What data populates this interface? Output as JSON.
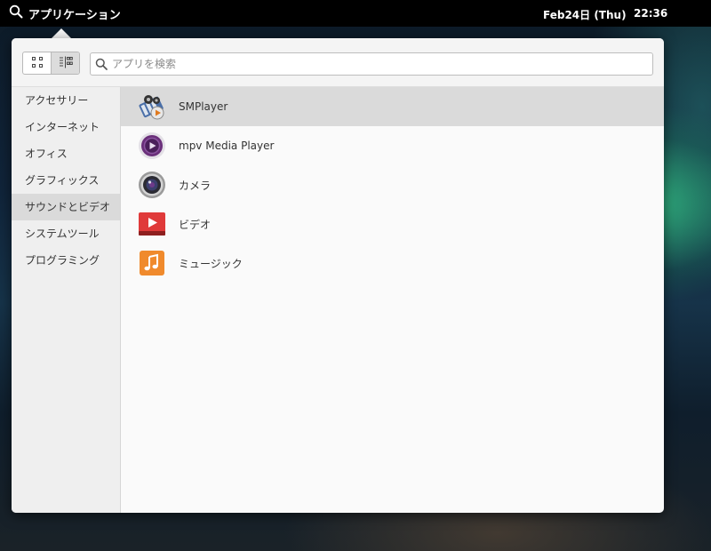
{
  "panel": {
    "apps_label": "アプリケーション",
    "date": "Feb24日 (Thu)",
    "time": "22:36",
    "icons": [
      "search-icon"
    ]
  },
  "menu": {
    "view_buttons": [
      {
        "icon": "grid-view-icon",
        "active": false
      },
      {
        "icon": "category-view-icon",
        "active": true
      }
    ],
    "search": {
      "placeholder": "アプリを検索",
      "value": "",
      "icon": "search-icon"
    },
    "categories": [
      {
        "label": "アクセサリー",
        "selected": false
      },
      {
        "label": "インターネット",
        "selected": false
      },
      {
        "label": "オフィス",
        "selected": false
      },
      {
        "label": "グラフィックス",
        "selected": false
      },
      {
        "label": "サウンドとビデオ",
        "selected": true
      },
      {
        "label": "システムツール",
        "selected": false
      },
      {
        "label": "プログラミング",
        "selected": false
      }
    ],
    "apps": [
      {
        "label": "SMPlayer",
        "icon": "smplayer-icon",
        "selected": true
      },
      {
        "label": "mpv Media Player",
        "icon": "mpv-icon",
        "selected": false
      },
      {
        "label": "カメラ",
        "icon": "camera-icon",
        "selected": false
      },
      {
        "label": "ビデオ",
        "icon": "video-icon",
        "selected": false
      },
      {
        "label": "ミュージック",
        "icon": "music-icon",
        "selected": false
      }
    ]
  },
  "colors": {
    "panel_bg": "#000000",
    "menu_bg": "#fafafa",
    "sidebar_bg": "#efefef",
    "selection_bg": "#dadada",
    "video_red": "#e03a3a",
    "music_orange": "#f08a2c",
    "mpv_purple": "#6a2f7a"
  }
}
